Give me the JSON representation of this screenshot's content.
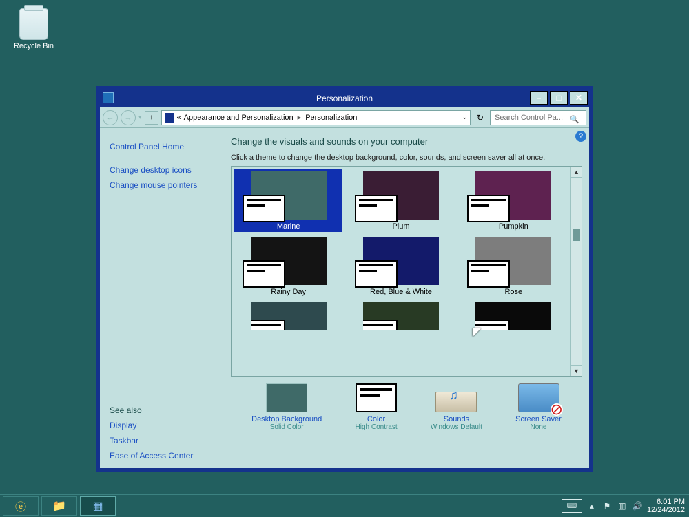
{
  "desktop": {
    "recycle_bin": "Recycle Bin"
  },
  "window": {
    "title": "Personalization",
    "breadcrumb": {
      "prefix": "«",
      "part1": "Appearance and Personalization",
      "part2": "Personalization"
    },
    "search_placeholder": "Search Control Pa...",
    "heading": "Change the visuals and sounds on your computer",
    "description": "Click a theme to change the desktop background, color, sounds, and screen saver all at once."
  },
  "sidebar": {
    "home": "Control Panel Home",
    "l1": "Change desktop icons",
    "l2": "Change mouse pointers",
    "see_also": "See also",
    "l3": "Display",
    "l4": "Taskbar",
    "l5": "Ease of Access Center"
  },
  "themes": [
    {
      "name": "Marine",
      "color": "#3f6a68",
      "selected": true
    },
    {
      "name": "Plum",
      "color": "#3a1d34",
      "selected": false
    },
    {
      "name": "Pumpkin",
      "color": "#5e2250",
      "selected": false
    },
    {
      "name": "Rainy Day",
      "color": "#141414",
      "selected": false
    },
    {
      "name": "Red, Blue & White",
      "color": "#131a6a",
      "selected": false
    },
    {
      "name": "Rose",
      "color": "#7d7d7d",
      "selected": false
    },
    {
      "name": "",
      "color": "#2e4a4e",
      "selected": false,
      "cut": true
    },
    {
      "name": "",
      "color": "#283a24",
      "selected": false,
      "cut": true
    },
    {
      "name": "",
      "color": "#0a0a0a",
      "selected": false,
      "cut": true
    }
  ],
  "bottom": {
    "bg": {
      "label": "Desktop Background",
      "sub": "Solid Color"
    },
    "color": {
      "label": "Color",
      "sub": "High Contrast"
    },
    "sound": {
      "label": "Sounds",
      "sub": "Windows Default"
    },
    "saver": {
      "label": "Screen Saver",
      "sub": "None"
    }
  },
  "taskbar": {
    "time": "6:01 PM",
    "date": "12/24/2012"
  }
}
